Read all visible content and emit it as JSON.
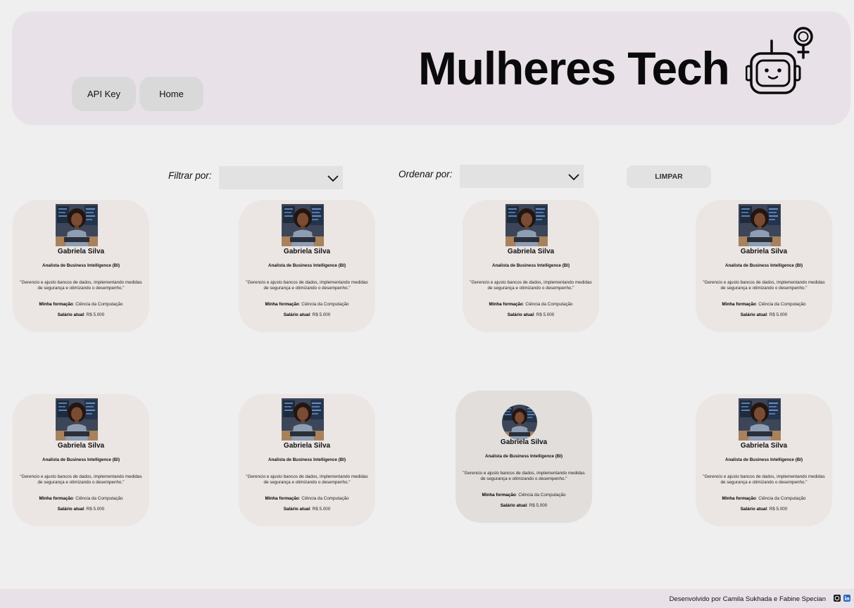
{
  "header": {
    "title": "Mulheres Tech",
    "nav": [
      {
        "label": "API Key"
      },
      {
        "label": "Home"
      }
    ],
    "logo_icon": "robot-female-symbol-icon"
  },
  "filters": {
    "filter_label": "Filtrar por:",
    "filter_value": "",
    "order_label": "Ordenar por:",
    "order_value": "",
    "clear_label": "LIMPAR",
    "dropdown_icon": "chevron-down-icon"
  },
  "cards": [
    {
      "name": "Gabriela Silva",
      "role": "Analista de Business Intelligence (BI)",
      "quote": "\"Gerencio e ajusto bancos de dados, implementando medidas de segurança e otimizando o desempenho.\"",
      "education_label": "Minha formação",
      "education": ": Ciência da Computação",
      "salary_label": "Salário atual",
      "salary": ": R$ 5.000"
    },
    {
      "name": "Gabriela Silva",
      "role": "Analista de Business Intelligence (BI)",
      "quote": "\"Gerencio e ajusto bancos de dados, implementando medidas de segurança e otimizando o desempenho.\"",
      "education_label": "Minha formação",
      "education": ": Ciência da Computação",
      "salary_label": "Salário atual",
      "salary": ": R$ 5.000"
    },
    {
      "name": "Gabriela Silva",
      "role": "Analista de Business Intelligence (BI)",
      "quote": "\"Gerencio e ajusto bancos de dados, implementando medidas de segurança e otimizando o desempenho.\"",
      "education_label": "Minha formação",
      "education": ": Ciência da Computação",
      "salary_label": "Salário atual",
      "salary": ": R$ 5.000"
    },
    {
      "name": "Gabriela Silva",
      "role": "Analista de Business Intelligence (BI)",
      "quote": "\"Gerencio e ajusto bancos de dados, implementando medidas de segurança e otimizando o desempenho.\"",
      "education_label": "Minha formação",
      "education": ": Ciência da Computação",
      "salary_label": "Salário atual",
      "salary": ": R$ 5.000"
    },
    {
      "name": "Gabriela Silva",
      "role": "Analista de Business Intelligence (BI)",
      "quote": "\"Gerencio e ajusto bancos de dados, implementando medidas de segurança e otimizando o desempenho.\"",
      "education_label": "Minha formação",
      "education": ": Ciência da Computação",
      "salary_label": "Salário atual",
      "salary": ": R$ 5.000"
    },
    {
      "name": "Gabriela Silva",
      "role": "Analista de Business Intelligence (BI)",
      "quote": "\"Gerencio e ajusto bancos de dados, implementando medidas de segurança e otimizando o desempenho.\"",
      "education_label": "Minha formação",
      "education": ": Ciência da Computação",
      "salary_label": "Salário atual",
      "salary": ": R$ 5.000"
    },
    {
      "name": "Gabriela Silva",
      "role": "Analista de Business Intelligence (BI)",
      "quote": "\"Gerencio e ajusto bancos de dados, implementando medidas de segurança e otimizando o desempenho.\"",
      "education_label": "Minha formação",
      "education": ": Ciência da Computação",
      "salary_label": "Salário atual",
      "salary": ": R$ 5.000"
    },
    {
      "name": "Gabriela Silva",
      "role": "Analista de Business Intelligence (BI)",
      "quote": "\"Gerencio e ajusto bancos de dados, implementando medidas de segurança e otimizando o desempenho.\"",
      "education_label": "Minha formação",
      "education": ": Ciência da Computação",
      "salary_label": "Salário atual",
      "salary": ": R$ 5.000"
    }
  ],
  "footer": {
    "credit": "Desenvolvido por Camila Sukhada e Fabine Specian",
    "icons": [
      "github-icon",
      "linkedin-icon"
    ]
  }
}
